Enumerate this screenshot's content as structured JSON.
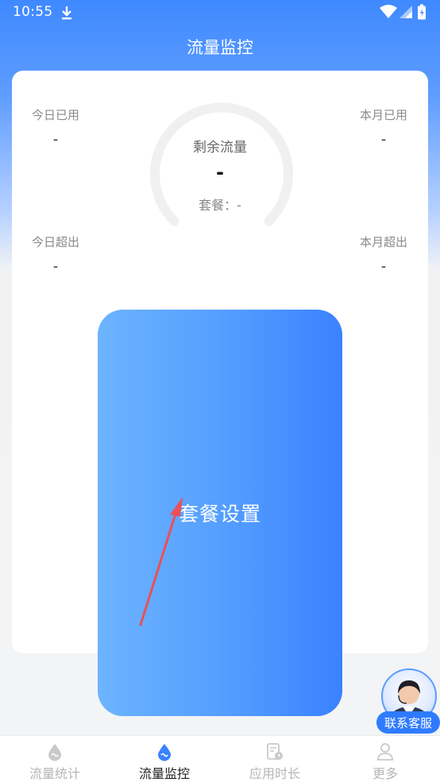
{
  "status_bar": {
    "time": "10:55"
  },
  "header": {
    "title": "流量监控"
  },
  "stats": {
    "today_used": {
      "label": "今日已用",
      "value": "-"
    },
    "month_used": {
      "label": "本月已用",
      "value": "-"
    },
    "today_exceeded": {
      "label": "今日超出",
      "value": "-"
    },
    "month_exceeded": {
      "label": "本月超出",
      "value": "-"
    }
  },
  "gauge": {
    "label": "剩余流量",
    "value": "-",
    "plan": "套餐：-"
  },
  "setup_button": {
    "label": "套餐设置"
  },
  "support": {
    "label": "联系客服"
  },
  "tabbar": {
    "items": [
      {
        "label": "流量统计",
        "icon": "drop-icon",
        "active": false
      },
      {
        "label": "流量监控",
        "icon": "drop-icon",
        "active": true
      },
      {
        "label": "应用时长",
        "icon": "doc-clock-icon",
        "active": false
      },
      {
        "label": "更多",
        "icon": "user-icon",
        "active": false
      }
    ]
  },
  "colors": {
    "accent": "#3a82ff",
    "header_top": "#3f89ff",
    "inactive": "#b5b5b5"
  }
}
